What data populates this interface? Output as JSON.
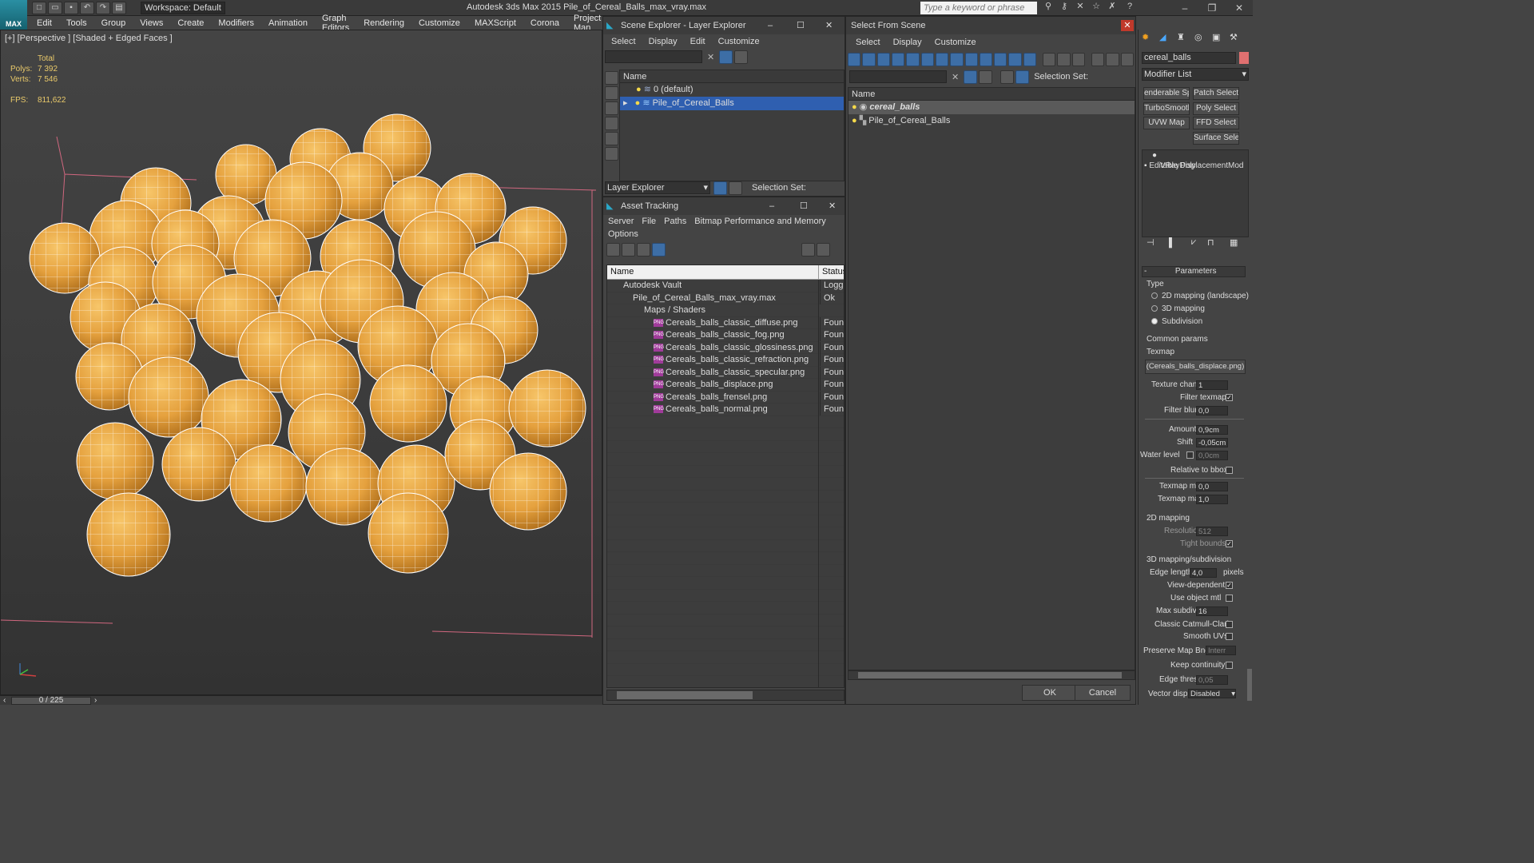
{
  "app": {
    "logo": "MAX",
    "title": "Autodesk 3ds Max  2015    Pile_of_Cereal_Balls_max_vray.max",
    "workspace": "Workspace: Default",
    "search_placeholder": "Type a keyword or phrase"
  },
  "menu": [
    "Edit",
    "Tools",
    "Group",
    "Views",
    "Create",
    "Modifiers",
    "Animation",
    "Graph Editors",
    "Rendering",
    "Customize",
    "MAXScript",
    "Corona",
    "Project Man"
  ],
  "viewport": {
    "label": "[+] [Perspective ] [Shaded + Edged Faces ]",
    "stats": {
      "total_label": "Total",
      "polys_label": "Polys:",
      "polys": "7 392",
      "verts_label": "Verts:",
      "verts": "7 546",
      "fps_label": "FPS:",
      "fps": "811,622"
    },
    "timeline": "0 / 225"
  },
  "scene_explorer": {
    "title": "Scene Explorer - Layer Explorer",
    "menu": [
      "Select",
      "Display",
      "Edit",
      "Customize"
    ],
    "col_name": "Name",
    "layers": [
      "0 (default)",
      "Pile_of_Cereal_Balls"
    ],
    "footer_dropdown": "Layer Explorer",
    "selection_set": "Selection Set:"
  },
  "asset_tracking": {
    "title": "Asset Tracking",
    "menu": [
      "Server",
      "File",
      "Paths",
      "Bitmap Performance and Memory"
    ],
    "menu2": "Options",
    "col_name": "Name",
    "col_status": "Status",
    "rows": [
      {
        "name": "Autodesk Vault",
        "status": "Logged",
        "indent": 0
      },
      {
        "name": "Pile_of_Cereal_Balls_max_vray.max",
        "status": "Ok",
        "indent": 1
      },
      {
        "name": "Maps / Shaders",
        "status": "",
        "indent": 2
      },
      {
        "name": "Cereals_balls_classic_diffuse.png",
        "status": "Found",
        "indent": 3
      },
      {
        "name": "Cereals_balls_classic_fog.png",
        "status": "Found",
        "indent": 3
      },
      {
        "name": "Cereals_balls_classic_glossiness.png",
        "status": "Found",
        "indent": 3
      },
      {
        "name": "Cereals_balls_classic_refraction.png",
        "status": "Found",
        "indent": 3
      },
      {
        "name": "Cereals_balls_classic_specular.png",
        "status": "Found",
        "indent": 3
      },
      {
        "name": "Cereals_balls_displace.png",
        "status": "Found",
        "indent": 3
      },
      {
        "name": "Cereals_balls_frensel.png",
        "status": "Found",
        "indent": 3
      },
      {
        "name": "Cereals_balls_normal.png",
        "status": "Found",
        "indent": 3
      }
    ],
    "png_badge": "PNG"
  },
  "select_from_scene": {
    "title": "Select From Scene",
    "menu": [
      "Select",
      "Display",
      "Customize"
    ],
    "selection_set": "Selection Set:",
    "col_name": "Name",
    "items": [
      "cereal_balls",
      "Pile_of_Cereal_Balls"
    ],
    "ok": "OK",
    "cancel": "Cancel"
  },
  "command_panel": {
    "object_name": "cereal_balls",
    "modifier_list": "Modifier List",
    "mod_buttons": [
      "enderable Spli",
      "Patch Select",
      "TurboSmooth",
      "Poly Select",
      "UVW Map",
      "FFD Select",
      "Surface Select"
    ],
    "stack": [
      "VRayDisplacementMod",
      "Editable Poly"
    ],
    "rollout": "Parameters",
    "type_label": "Type",
    "type_options": [
      "2D mapping (landscape)",
      "3D mapping",
      "Subdivision"
    ],
    "common_params": "Common params",
    "texmap_label": "Texmap",
    "texmap_value": "(Cereals_balls_displace.png)",
    "texture_chan_label": "Texture chan",
    "texture_chan": "1",
    "filter_texmap": "Filter texmap",
    "filter_blur_label": "Filter blur",
    "filter_blur": "0,0",
    "amount_label": "Amount",
    "amount": "0,9cm",
    "shift_label": "Shift",
    "shift": "-0,05cm",
    "water_level_label": "Water level",
    "water_level": "0,0cm",
    "relative_bbox": "Relative to bbox",
    "texmap_min_label": "Texmap min",
    "texmap_min": "0,0",
    "texmap_max_label": "Texmap max",
    "texmap_max": "1,0",
    "mapping2d": "2D mapping",
    "resolution_label": "Resolution",
    "resolution": "512",
    "tight_bounds": "Tight bounds",
    "mapping3d": "3D mapping/subdivision",
    "edge_length_label": "Edge length",
    "edge_length": "4,0",
    "pixels": "pixels",
    "view_dependent": "View-dependent",
    "use_object_mtl": "Use object mtl",
    "max_subdivs_label": "Max subdivs",
    "max_subdivs": "16",
    "catmull": "Classic Catmull-Clark",
    "smooth_uvs": "Smooth UVs",
    "preserve_label": "Preserve Map Bnd",
    "preserve": "Interr",
    "keep_continuity": "Keep continuity",
    "edge_thresh_label": "Edge thresh",
    "edge_thresh": "0,05",
    "vector_displ_label": "Vector displ",
    "vector_displ": "Disabled"
  }
}
